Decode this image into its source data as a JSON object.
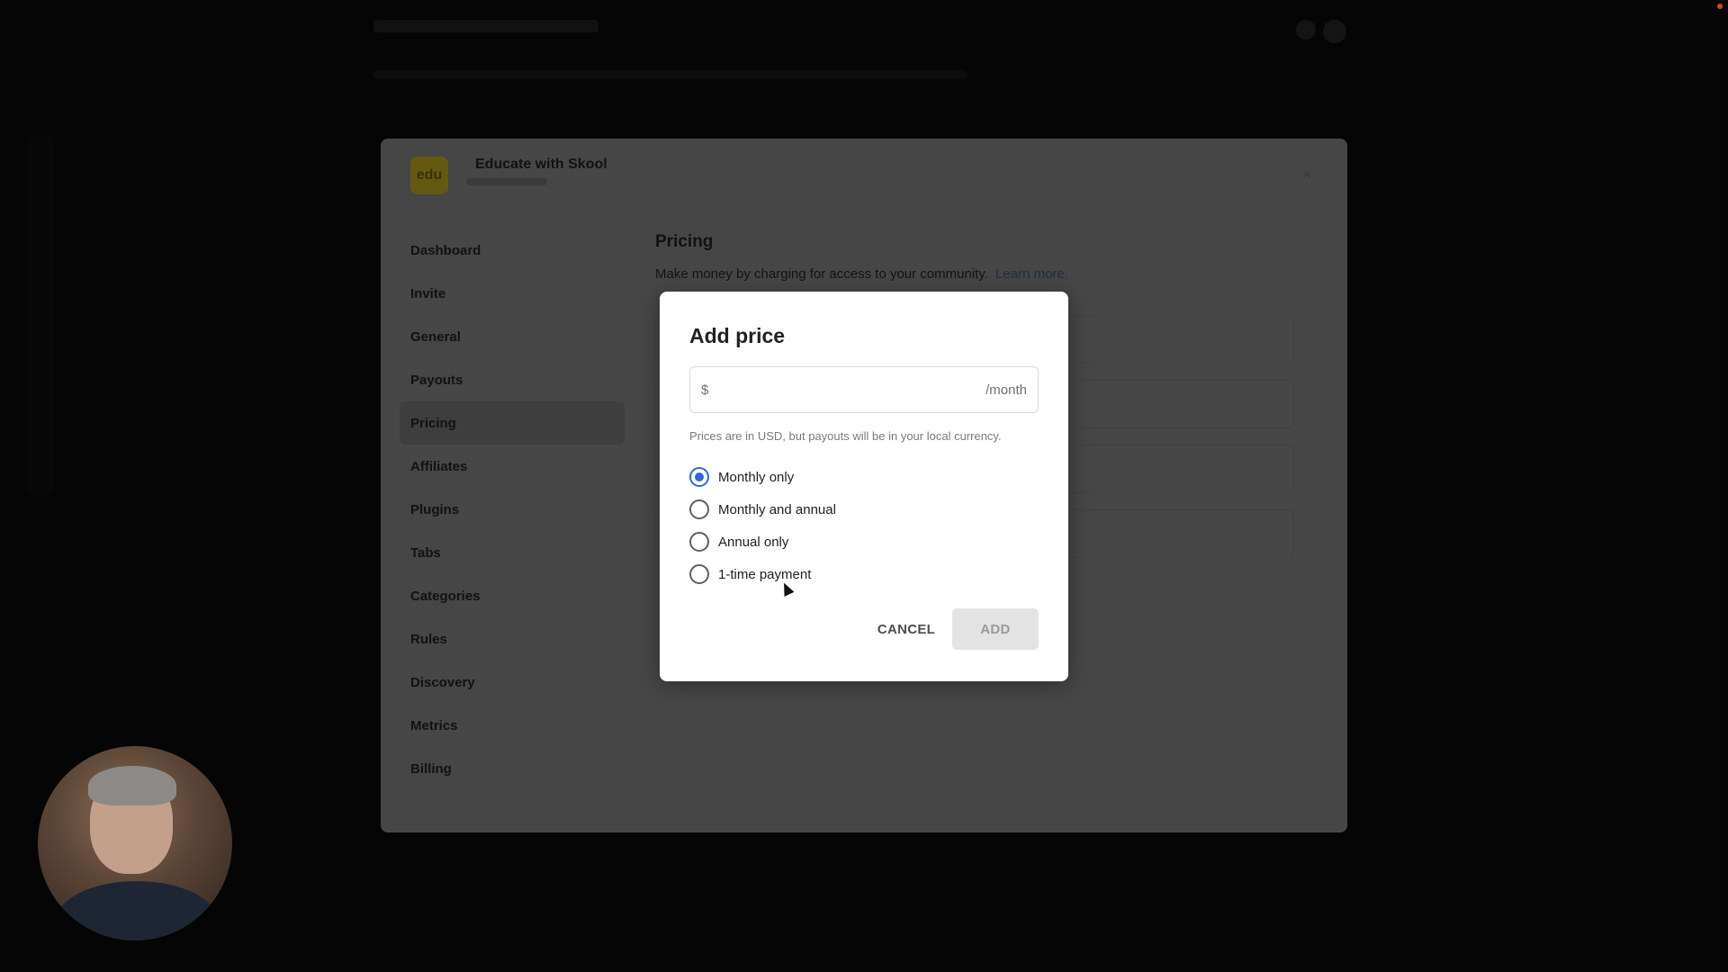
{
  "settings": {
    "community_name": "Educate with Skool",
    "logo_text": "edu",
    "close_icon": "×",
    "nav_items": [
      "Dashboard",
      "Invite",
      "General",
      "Payouts",
      "Pricing",
      "Affiliates",
      "Plugins",
      "Tabs",
      "Categories",
      "Rules",
      "Discovery",
      "Metrics",
      "Billing"
    ],
    "active_nav": "Pricing",
    "pricing_title": "Pricing",
    "pricing_description": "Make money by charging for access to your community.",
    "learn_more": "Learn more."
  },
  "modal": {
    "title": "Add price",
    "currency_symbol": "$",
    "price_value": "",
    "unit": "/month",
    "helper_text": "Prices are in USD, but payouts will be in your local currency.",
    "options": [
      {
        "label": "Monthly only",
        "checked": true
      },
      {
        "label": "Monthly and annual",
        "checked": false
      },
      {
        "label": "Annual only",
        "checked": false
      },
      {
        "label": "1-time payment",
        "checked": false
      }
    ],
    "cancel_label": "CANCEL",
    "add_label": "ADD"
  },
  "colors": {
    "accent": "#3366d6",
    "modal_bg": "#ffffff",
    "add_disabled_bg": "#e3e3e3"
  }
}
